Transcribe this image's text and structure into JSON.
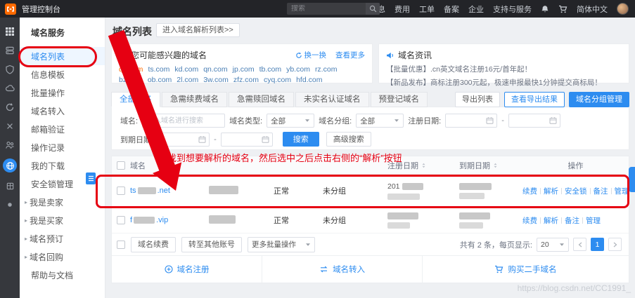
{
  "colors": {
    "accent": "#2d8cf0",
    "annotation": "#e60012",
    "domain_highlight": "#ff6a00",
    "topbar": "#232428"
  },
  "topbar": {
    "title": "管理控制台",
    "search_placeholder": "搜索",
    "items": [
      "消息",
      "费用",
      "工单",
      "备案",
      "企业",
      "支持与服务"
    ],
    "language": "简体中文"
  },
  "sidebar": {
    "title": "域名服务",
    "items": [
      {
        "label": "域名列表"
      },
      {
        "label": "信息模板"
      },
      {
        "label": "批量操作"
      },
      {
        "label": "域名转入"
      },
      {
        "label": "邮箱验证"
      },
      {
        "label": "操作记录"
      },
      {
        "label": "我的下载"
      },
      {
        "label": "安全锁管理"
      },
      {
        "label": "我是卖家"
      },
      {
        "label": "我是买家"
      },
      {
        "label": "域名预订"
      },
      {
        "label": "域名回购"
      },
      {
        "label": "帮助与文档"
      }
    ]
  },
  "page": {
    "title": "域名列表",
    "dns_button": "进入域名解析列表>>"
  },
  "interest": {
    "title": "您可能感兴趣的域名",
    "domains": [
      "qd.com",
      "ts.com",
      "kd.com",
      "qn.com",
      "jp.com",
      "tb.com",
      "yb.com",
      "rz.com",
      "bz.com",
      "ob.com",
      "2l.com",
      "3w.com",
      "zfz.com",
      "cyq.com",
      "hfd.com"
    ],
    "refresh": "换一换",
    "more": "查看更多"
  },
  "news": {
    "title": "域名资讯",
    "line1": "【批量优惠】.cn英文域名注册16元/首年起！",
    "line2": "【新品发布】商标注册300元起，极速申报最快1分钟提交商标局！"
  },
  "tabs": [
    {
      "label": "全部域名"
    },
    {
      "label": "急需续费域名"
    },
    {
      "label": "急需赎回域名"
    },
    {
      "label": "未实名认证域名"
    },
    {
      "label": "预登记域名"
    }
  ],
  "toolbar": {
    "export": "导出列表",
    "export_result": "查看导出结果",
    "group_manage": "域名分组管理"
  },
  "filters": {
    "domain_label": "域名:",
    "domain_placeholder": "输入域名进行搜索",
    "type_label": "域名类型:",
    "type_value": "全部",
    "group_label": "域名分组:",
    "group_value": "全部",
    "reg_label": "注册日期:",
    "expire_label": "到期日期:",
    "range_sep": "-",
    "search": "搜索",
    "advanced": "高级搜索"
  },
  "table": {
    "headers": {
      "domain": "域名",
      "reg": "注册日期",
      "expire": "到期日期",
      "actions": "操作"
    },
    "rows": [
      {
        "domain_prefix": "ts",
        "domain_suffix": ".net",
        "status": "正常",
        "group": "未分组",
        "reg_fragment": "201",
        "actions": [
          "续费",
          "解析",
          "安全锁",
          "备注",
          "管理"
        ]
      },
      {
        "domain_prefix": "f",
        "domain_suffix": ".vip",
        "status": "正常",
        "group": "未分组",
        "reg_fragment": "",
        "actions": [
          "续费",
          "解析",
          "备注",
          "管理"
        ]
      }
    ]
  },
  "batch": {
    "renew": "域名续费",
    "transfer": "转至其他账号",
    "more": "更多批量操作",
    "summary": "共有 2 条，每页显示:",
    "page_size": "20",
    "page": "1"
  },
  "footer": {
    "register": "域名注册",
    "transfer_in": "域名转入",
    "buy": "购买二手域名"
  },
  "annotations": {
    "tip": "找到想要解析的域名，然后选中之后点击右侧的“解析”按钮"
  },
  "watermark": "https://blog.csdn.net/CC1991_"
}
